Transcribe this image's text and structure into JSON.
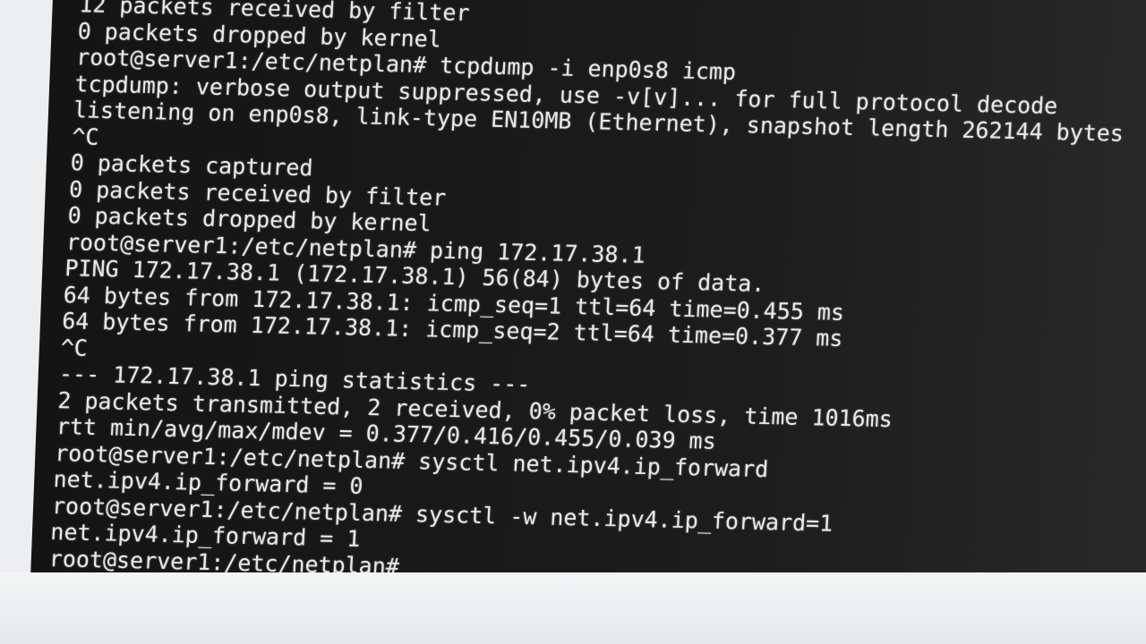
{
  "terminal": {
    "lines": [
      "12 packets received by filter",
      "0 packets dropped by kernel",
      "root@server1:/etc/netplan# tcpdump -i enp0s8 icmp",
      "tcpdump: verbose output suppressed, use -v[v]... for full protocol decode",
      "listening on enp0s8, link-type EN10MB (Ethernet), snapshot length 262144 bytes",
      "^C",
      "0 packets captured",
      "0 packets received by filter",
      "0 packets dropped by kernel",
      "root@server1:/etc/netplan# ping 172.17.38.1",
      "PING 172.17.38.1 (172.17.38.1) 56(84) bytes of data.",
      "64 bytes from 172.17.38.1: icmp_seq=1 ttl=64 time=0.455 ms",
      "64 bytes from 172.17.38.1: icmp_seq=2 ttl=64 time=0.377 ms",
      "^C",
      "--- 172.17.38.1 ping statistics ---",
      "2 packets transmitted, 2 received, 0% packet loss, time 1016ms",
      "rtt min/avg/max/mdev = 0.377/0.416/0.455/0.039 ms",
      "root@server1:/etc/netplan# sysctl net.ipv4.ip_forward",
      "net.ipv4.ip_forward = 0",
      "root@server1:/etc/netplan# sysctl -w net.ipv4.ip_forward=1",
      "net.ipv4.ip_forward = 1"
    ],
    "prompt": "root@server1:/etc/netplan# "
  }
}
